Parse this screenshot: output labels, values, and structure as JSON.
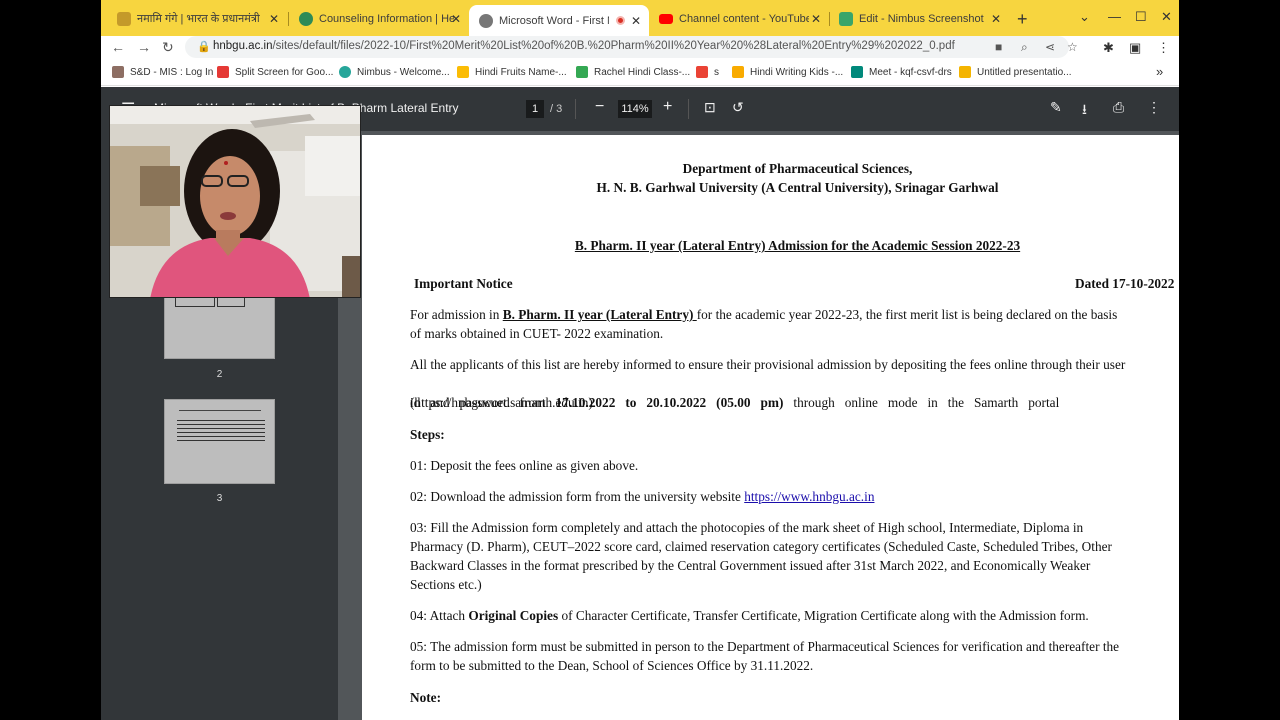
{
  "browser": {
    "tabs": [
      {
        "label": "नमामि गंगे | भारत के प्रधानमंत्री",
        "icon": "emblem-icon"
      },
      {
        "label": "Counseling Information | Hem",
        "icon": "university-icon"
      },
      {
        "label": "Microsoft Word - First Me",
        "icon": "globe-icon",
        "active": true
      },
      {
        "label": "Channel content - YouTube St",
        "icon": "youtube-icon"
      },
      {
        "label": "Edit - Nimbus Screenshot",
        "icon": "nimbus-icon"
      }
    ],
    "close_glyph": "✕",
    "url_host": "hnbgu.ac.in",
    "url_path": "/sites/default/files/2022-10/First%20Merit%20List%20of%20B.%20Pharm%20II%20Year%20%28Lateral%20Entry%29%202022_0.pdf",
    "bookmarks": [
      {
        "label": "S&D - MIS : Log In",
        "color": "#8d6e63"
      },
      {
        "label": "Split Screen for Goo...",
        "color": "#e53935"
      },
      {
        "label": "Nimbus - Welcome...",
        "color": "#26a69a"
      },
      {
        "label": "Hindi Fruits Name-...",
        "color": "#fbbc04"
      },
      {
        "label": "Rachel Hindi Class-...",
        "color": "#34a853"
      },
      {
        "label": "s",
        "color": "#ea4335"
      },
      {
        "label": "Hindi Writing Kids -...",
        "color": "#f9ab00"
      },
      {
        "label": "Meet - kqf-csvf-drs",
        "color": "#00897b"
      },
      {
        "label": "Untitled presentatio...",
        "color": "#f4b400"
      }
    ],
    "overflow_glyph": "»"
  },
  "pdf": {
    "title": "Microsoft Word - First Merit List of B. Pharm Lateral Entry",
    "page_current": "1",
    "page_total": "/ 3",
    "zoom": "114%",
    "thumbnails": [
      "2",
      "3"
    ]
  },
  "doc": {
    "dept": "Department of Pharmaceutical Sciences,",
    "univ": "H. N. B. Garhwal University (A Central University), Srinagar Garhwal",
    "heading": "B. Pharm. II year (Lateral Entry) Admission for the Academic Session 2022-23",
    "notice": "Important Notice",
    "dated": "Dated 17-10-2022",
    "p1_a": "For admission in ",
    "p1_b": "B. Pharm. II year (Lateral Entry) ",
    "p1_c": "for the academic year 2022-23, the first  merit list is being declared on the basis",
    "p1_d": "of marks obtained in CUET- 2022 examination.",
    "p2_l1": "All the applicants of this list are hereby informed to ensure their provisional admission by depositing the fees online through their user",
    "p2_l2a": "id   and   password   from   ",
    "p2_l2b": "17.10.2022   to   20.10.2022   (05.00   pm)",
    "p2_l2c": "   through   online   mode   in   the   Samarth   portal",
    "p2_l3": "(https://hnbgucuet.samarth.edu.in).",
    "steps": "Steps:",
    "s1": "01: Deposit the fees online as given above.",
    "s2a": "02: Download the admission form from the university website ",
    "s2b": "https://www.hnbgu.ac.in",
    "s3_l1": "03: Fill the Admission form completely and attach the photocopies of the mark sheet of High school, Intermediate, Diploma in",
    "s3_l2": "Pharmacy (D. Pharm), CEUT–2022 score card, claimed reservation category certificates (Scheduled Caste, Scheduled Tribes, Other",
    "s3_l3": "Backward Classes in the format prescribed by the Central Government issued after 31st March 2022, and Economically Weaker",
    "s3_l4": "Sections etc.)",
    "s4a": "04: Attach ",
    "s4b": "Original Copies",
    "s4c": " of Character Certificate, Transfer Certificate, Migration Certificate along with the Admission form.",
    "s5_l1": "05: The admission form must be submitted in person to the Department of Pharmaceutical Sciences for verification and thereafter the",
    "s5_l2": "form to be submitted to the Dean, School of Sciences Office by 31.11.2022.",
    "note": "Note:"
  }
}
